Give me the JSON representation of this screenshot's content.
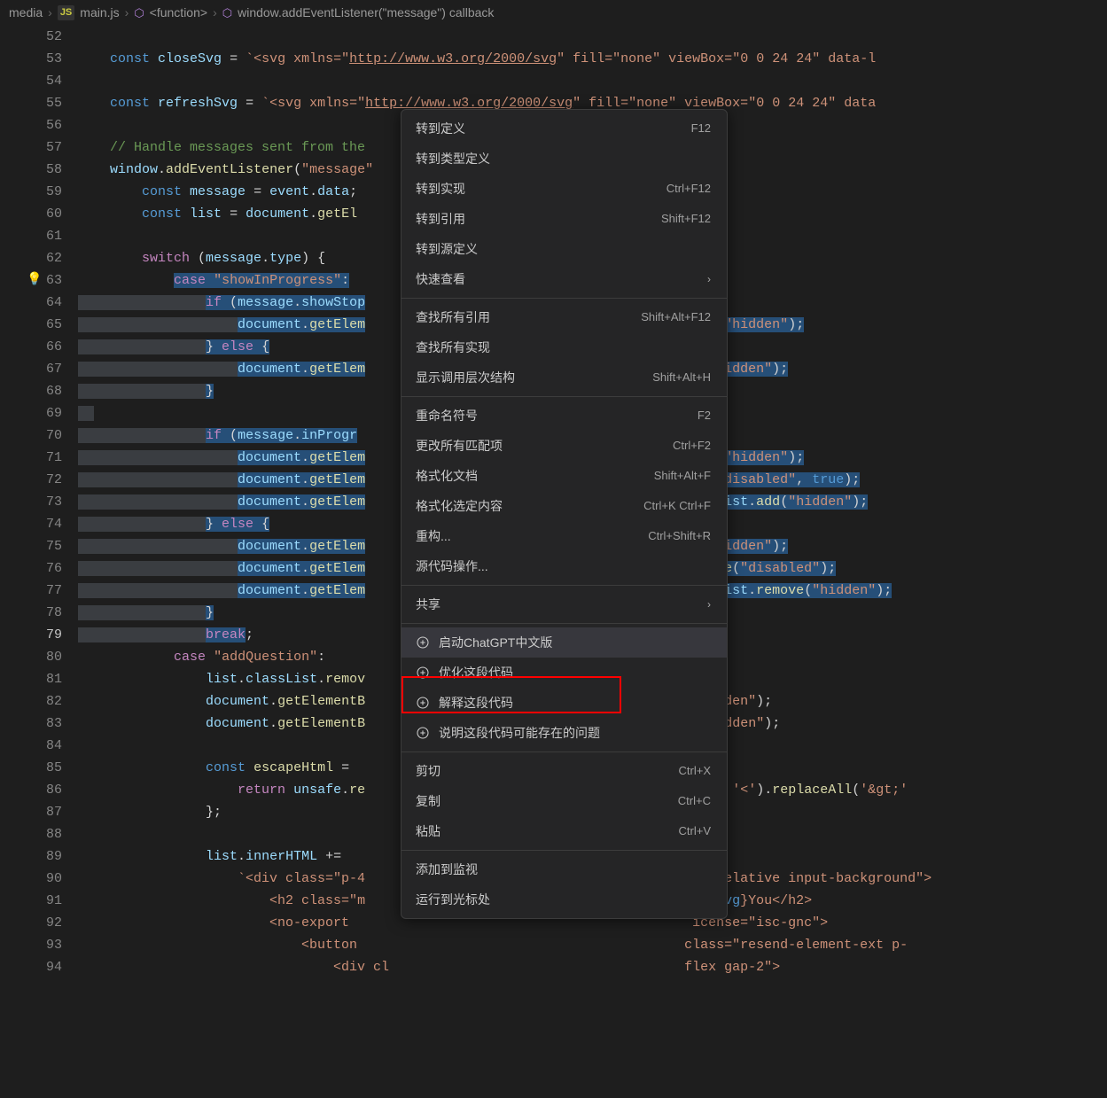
{
  "breadcrumbs": {
    "b1": "media",
    "b2": "main.js",
    "b3": "<function>",
    "b4": "window.addEventListener(\"message\") callback"
  },
  "gutter": {
    "start": 52,
    "end": 94,
    "current": 79
  },
  "code": {
    "l52": "",
    "l53_a": "const",
    "l53_b": "closeSvg",
    "l53_c": " = ",
    "l53_d": "`<svg xmlns=\"",
    "l53_e": "http://www.w3.org/2000/svg",
    "l53_f": "\" fill=\"none\" viewBox=\"0 0 24 24\" data-l",
    "l54": "",
    "l55_a": "const",
    "l55_b": "refreshSvg",
    "l55_c": " = ",
    "l55_d": "`<svg xmlns=\"",
    "l55_e": "http://www.w3.org/2000/svg",
    "l55_f": "\" fill=\"none\" viewBox=\"0 0 24 24\" data",
    "l56": "",
    "l57": "// Handle messages sent from the",
    "l58_a": "window",
    "l58_b": ".",
    "l58_c": "addEventListener",
    "l58_d": "(",
    "l58_e": "\"message\"",
    "l59_a": "const",
    "l59_b": "message",
    "l59_c": " = ",
    "l59_d": "event",
    "l59_e": ".",
    "l59_f": "data",
    "l59_g": ";",
    "l60_a": "const",
    "l60_b": "list",
    "l60_c": " = ",
    "l60_d": "document",
    "l60_e": ".",
    "l60_f": "getEl",
    "l61": "",
    "l62_a": "switch",
    "l62_b": " (",
    "l62_c": "message",
    "l62_d": ".",
    "l62_e": "type",
    "l62_f": ") {",
    "l63_a": "case",
    "l63_b": "\"showInProgress\"",
    "l63_c": ":",
    "l64_a": "if",
    "l64_b": " (",
    "l64_c": "message",
    "l64_d": ".",
    "l64_e": "showStop",
    "l65_a": "document",
    "l65_b": ".",
    "l65_c": "getElem",
    "l65_r1": "ove",
    "l65_r2": "(",
    "l65_r3": "\"hidden\"",
    "l65_r4": ");",
    "l66_a": "} ",
    "l66_b": "else",
    "l66_c": " {",
    "l67_a": "document",
    "l67_b": ".",
    "l67_c": "getElem",
    "l67_r1": "(",
    "l67_r2": "\"hidden\"",
    "l67_r3": ");",
    "l68_a": "}",
    "l69": "",
    "l70_a": "if",
    "l70_b": " (",
    "l70_c": "message",
    "l70_d": ".",
    "l70_e": "inProgr",
    "l71_a": "document",
    "l71_b": ".",
    "l71_c": "getElem",
    "l71_r1": "ove",
    "l71_r2": "(",
    "l71_r3": "\"hidden\"",
    "l71_r4": ");",
    "l72_a": "document",
    "l72_b": ".",
    "l72_c": "getElem",
    "l72_r1": "te",
    "l72_r2": "(",
    "l72_r3": "\"disabled\"",
    "l72_r4": ", ",
    "l72_r5": "true",
    "l72_r6": ");",
    "l73_a": "document",
    "l73_b": ".",
    "l73_c": "getElem",
    "l73_r1": "assList",
    "l73_r2": ".",
    "l73_r3": "add",
    "l73_r4": "(",
    "l73_r5": "\"hidden\"",
    "l73_r6": ");",
    "l74_a": "} ",
    "l74_b": "else",
    "l74_c": " {",
    "l75_a": "document",
    "l75_b": ".",
    "l75_c": "getElem",
    "l75_r1": "(",
    "l75_r2": "\"hidden\"",
    "l75_r3": ");",
    "l76_a": "document",
    "l76_b": ".",
    "l76_c": "getElem",
    "l76_r1": "ibute",
    "l76_r2": "(",
    "l76_r3": "\"disabled\"",
    "l76_r4": ");",
    "l77_a": "document",
    "l77_b": ".",
    "l77_c": "getElem",
    "l77_r1": "assList",
    "l77_r2": ".",
    "l77_r3": "remove",
    "l77_r4": "(",
    "l77_r5": "\"hidden\"",
    "l77_r6": ");",
    "l78_a": "}",
    "l79_a": "break",
    "l79_b": ";",
    "l80_a": "case",
    "l80_b": "\"addQuestion\"",
    "l80_c": ":",
    "l81_a": "list",
    "l81_b": ".",
    "l81_c": "classList",
    "l81_d": ".",
    "l81_e": "remov",
    "l82_a": "document",
    "l82_b": ".",
    "l82_c": "getElementB",
    "l82_r1": "\"hidden\"",
    "l82_r2": ");",
    "l83_a": "document",
    "l83_b": ".",
    "l83_c": "getElementB",
    "l83_r1": "dd",
    "l83_r2": "(",
    "l83_r3": "\"hidden\"",
    "l83_r4": ");",
    "l84": "",
    "l85_a": "const",
    "l85_b": "escapeHtml",
    "l85_c": " = ",
    "l86_a": "return",
    "l86_b": "unsafe",
    "l86_c": ".",
    "l86_d": "re",
    "l86_r1": "lt;'",
    "l86_r2": ", ",
    "l86_r3": "'<'",
    "l86_r4": ").",
    "l86_r5": "replaceAll",
    "l86_r6": "(",
    "l86_r7": "'&gt;'",
    "l87_a": "};",
    "l88": "",
    "l89_a": "list",
    "l89_b": ".",
    "l89_c": "innerHTML",
    "l89_d": " +=",
    "l90_a": "`<div class=\"p-4",
    "l90_r": "relative input-background\">",
    "l91_a": "<h2 class=\"m",
    "l91_r1": "serSvg",
    "l91_r2": "}",
    "l91_r3": "You</h2>",
    "l92_a": "<no-export ",
    "l92_r": "icense=\"isc-gnc\">",
    "l93_a": "<button",
    "l93_r": "class=\"resend-element-ext p-",
    "l94_a": "<div cl",
    "l94_r": "flex gap-2\">"
  },
  "menu": {
    "i1": {
      "label": "转到定义",
      "kb": "F12"
    },
    "i2": {
      "label": "转到类型定义"
    },
    "i3": {
      "label": "转到实现",
      "kb": "Ctrl+F12"
    },
    "i4": {
      "label": "转到引用",
      "kb": "Shift+F12"
    },
    "i5": {
      "label": "转到源定义"
    },
    "i6": {
      "label": "快速查看"
    },
    "i7": {
      "label": "查找所有引用",
      "kb": "Shift+Alt+F12"
    },
    "i8": {
      "label": "查找所有实现"
    },
    "i9": {
      "label": "显示调用层次结构",
      "kb": "Shift+Alt+H"
    },
    "i10": {
      "label": "重命名符号",
      "kb": "F2"
    },
    "i11": {
      "label": "更改所有匹配项",
      "kb": "Ctrl+F2"
    },
    "i12": {
      "label": "格式化文档",
      "kb": "Shift+Alt+F"
    },
    "i13": {
      "label": "格式化选定内容",
      "kb": "Ctrl+K Ctrl+F"
    },
    "i14": {
      "label": "重构...",
      "kb": "Ctrl+Shift+R"
    },
    "i15": {
      "label": "源代码操作..."
    },
    "i16": {
      "label": "共享"
    },
    "i17": {
      "label": "启动ChatGPT中文版"
    },
    "i18": {
      "label": "优化这段代码"
    },
    "i19": {
      "label": "解释这段代码"
    },
    "i20": {
      "label": "说明这段代码可能存在的问题"
    },
    "i21": {
      "label": "剪切",
      "kb": "Ctrl+X"
    },
    "i22": {
      "label": "复制",
      "kb": "Ctrl+C"
    },
    "i23": {
      "label": "粘贴",
      "kb": "Ctrl+V"
    },
    "i24": {
      "label": "添加到监视"
    },
    "i25": {
      "label": "运行到光标处"
    }
  }
}
